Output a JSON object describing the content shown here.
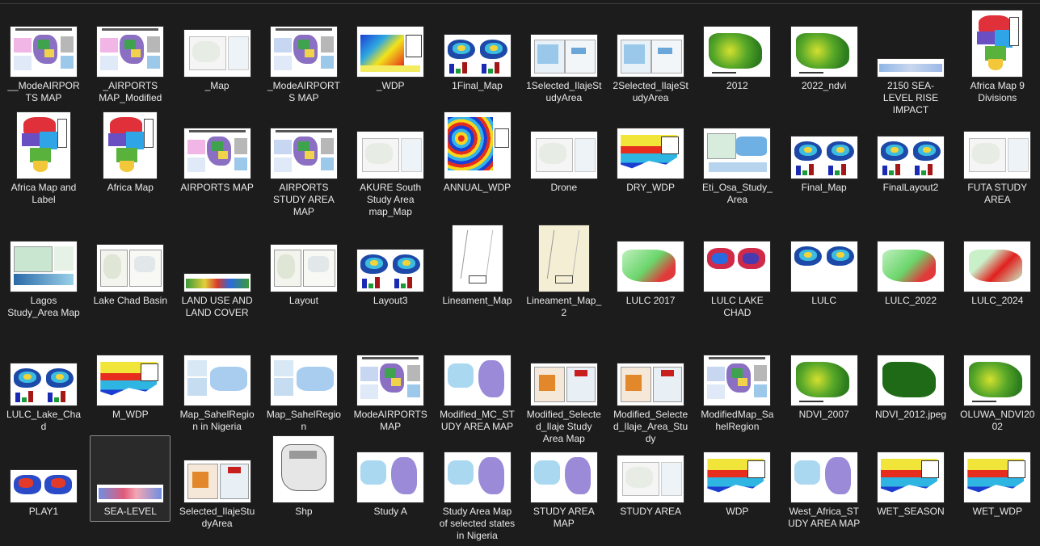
{
  "colors": {
    "background": "#1c1c1c",
    "text": "#e8e8e8",
    "selected_border": "#8a8a8a"
  },
  "files": [
    {
      "name": "__ModeAIRPORTS MAP",
      "style": "nigeria-pink"
    },
    {
      "name": "_AIRPORTS MAP_Modified",
      "style": "nigeria-pink"
    },
    {
      "name": "_Map",
      "style": "grey-lines"
    },
    {
      "name": "_ModeAIRPORTS MAP",
      "style": "nigeria-purple"
    },
    {
      "name": "_WDP",
      "style": "wdp-heat"
    },
    {
      "name": "1Final_Map",
      "style": "lake-chad-bars"
    },
    {
      "name": "1Selected_IlajeStudyArea",
      "style": "blue-panels"
    },
    {
      "name": "2Selected_IlajeStudyArea",
      "style": "blue-panels"
    },
    {
      "name": "2012",
      "style": "green-ndvi"
    },
    {
      "name": "2022_ndvi",
      "style": "green-ndvi"
    },
    {
      "name": "2150 SEA-LEVEL RISE IMPACT",
      "style": "sea-strip"
    },
    {
      "name": "Africa Map 9 Divisions",
      "style": "africa-tall"
    },
    {
      "name": "Africa Map and Label",
      "style": "africa"
    },
    {
      "name": "Africa Map",
      "style": "africa"
    },
    {
      "name": "AIRPORTS MAP",
      "style": "nigeria-pink"
    },
    {
      "name": "AIRPORTS STUDY AREA MAP",
      "style": "nigeria-purple"
    },
    {
      "name": "AKURE South Study Area map_Map",
      "style": "grey-lines"
    },
    {
      "name": "ANNUAL_WDP",
      "style": "annual-wdp"
    },
    {
      "name": "Drone",
      "style": "grey-lines"
    },
    {
      "name": "DRY_WDP",
      "style": "wdp-colour"
    },
    {
      "name": "Eti_Osa_Study_Area",
      "style": "eti-osa"
    },
    {
      "name": "Final_Map",
      "style": "lake-chad-bars"
    },
    {
      "name": "FinalLayout2",
      "style": "lake-chad-bars"
    },
    {
      "name": "FUTA STUDY AREA",
      "style": "grey-lines"
    },
    {
      "name": "Lagos Study_Area Map",
      "style": "lagos"
    },
    {
      "name": "Lake Chad Basin",
      "style": "grey-panels"
    },
    {
      "name": "LAND USE AND LAND COVER",
      "style": "landuse-strip"
    },
    {
      "name": "Layout",
      "style": "grey-panels"
    },
    {
      "name": "Layout3",
      "style": "lake-chad-bars"
    },
    {
      "name": "Lineament_Map",
      "style": "lineament"
    },
    {
      "name": "Lineament_Map_2",
      "style": "lineament-2"
    },
    {
      "name": "LULC 2017",
      "style": "lulc-green"
    },
    {
      "name": "LULC LAKE CHAD",
      "style": "lulc-lake"
    },
    {
      "name": "LULC",
      "style": "lake-chad-plain"
    },
    {
      "name": "LULC_2022",
      "style": "lulc-green"
    },
    {
      "name": "LULC_2024",
      "style": "lulc-red"
    },
    {
      "name": "LULC_Lake_Chad",
      "style": "lake-chad-bars"
    },
    {
      "name": "M_WDP",
      "style": "m-wdp"
    },
    {
      "name": "Map_SahelRegion in Nigeria",
      "style": "sahel"
    },
    {
      "name": "Map_SahelRegion",
      "style": "sahel"
    },
    {
      "name": "ModeAIRPORTS MAP",
      "style": "nigeria-purple"
    },
    {
      "name": "Modified_MC_STUDY AREA MAP",
      "style": "africa-purple"
    },
    {
      "name": "Modified_Selected_Ilaje Study Area Map",
      "style": "ilaje-red"
    },
    {
      "name": "Modified_Selected_Ilaje_Area_Study",
      "style": "ilaje-red"
    },
    {
      "name": "ModifiedMap_SahelRegion",
      "style": "nigeria-purple"
    },
    {
      "name": "NDVI_2007",
      "style": "green-ndvi"
    },
    {
      "name": "NDVI_2012.jpeg",
      "style": "dark-green"
    },
    {
      "name": "OLUWA_NDVI2002",
      "style": "green-ndvi"
    },
    {
      "name": "PLAY1",
      "style": "play"
    },
    {
      "name": "SEA-LEVEL",
      "style": "sea-level",
      "selected": true
    },
    {
      "name": "Selected_IlajeStudyArea",
      "style": "ilaje-red"
    },
    {
      "name": "Shp",
      "style": "shp"
    },
    {
      "name": "Study A",
      "style": "africa-purple"
    },
    {
      "name": "Study Area Map of selected states in Nigeria",
      "style": "africa-purple"
    },
    {
      "name": "STUDY AREA MAP",
      "style": "africa-purple"
    },
    {
      "name": "STUDY AREA",
      "style": "grey-lines"
    },
    {
      "name": "WDP",
      "style": "wdp-colour"
    },
    {
      "name": "West_Africa_STUDY AREA MAP",
      "style": "africa-purple"
    },
    {
      "name": "WET_SEASON",
      "style": "wdp-colour"
    },
    {
      "name": "WET_WDP",
      "style": "wdp-colour"
    }
  ]
}
